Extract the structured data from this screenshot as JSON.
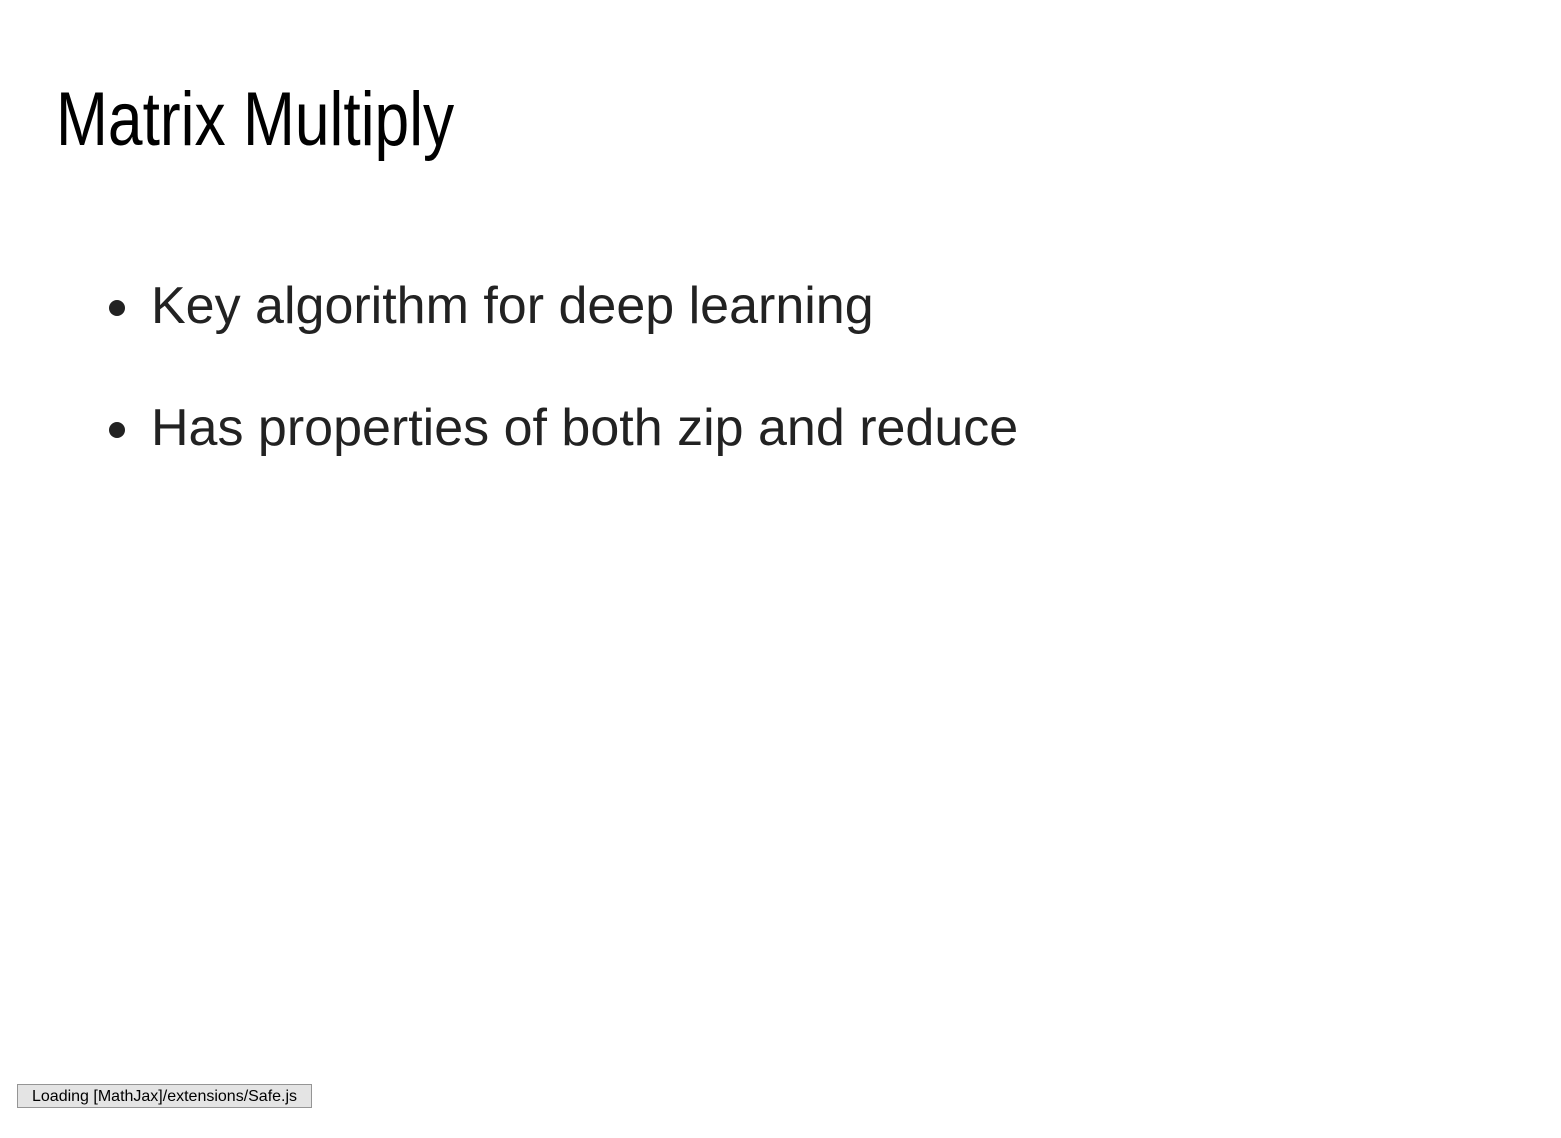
{
  "slide": {
    "title": "Matrix Multiply",
    "bullets": [
      "Key algorithm for deep learning",
      "Has properties of both zip and reduce"
    ]
  },
  "status_message": "Loading [MathJax]/extensions/Safe.js"
}
